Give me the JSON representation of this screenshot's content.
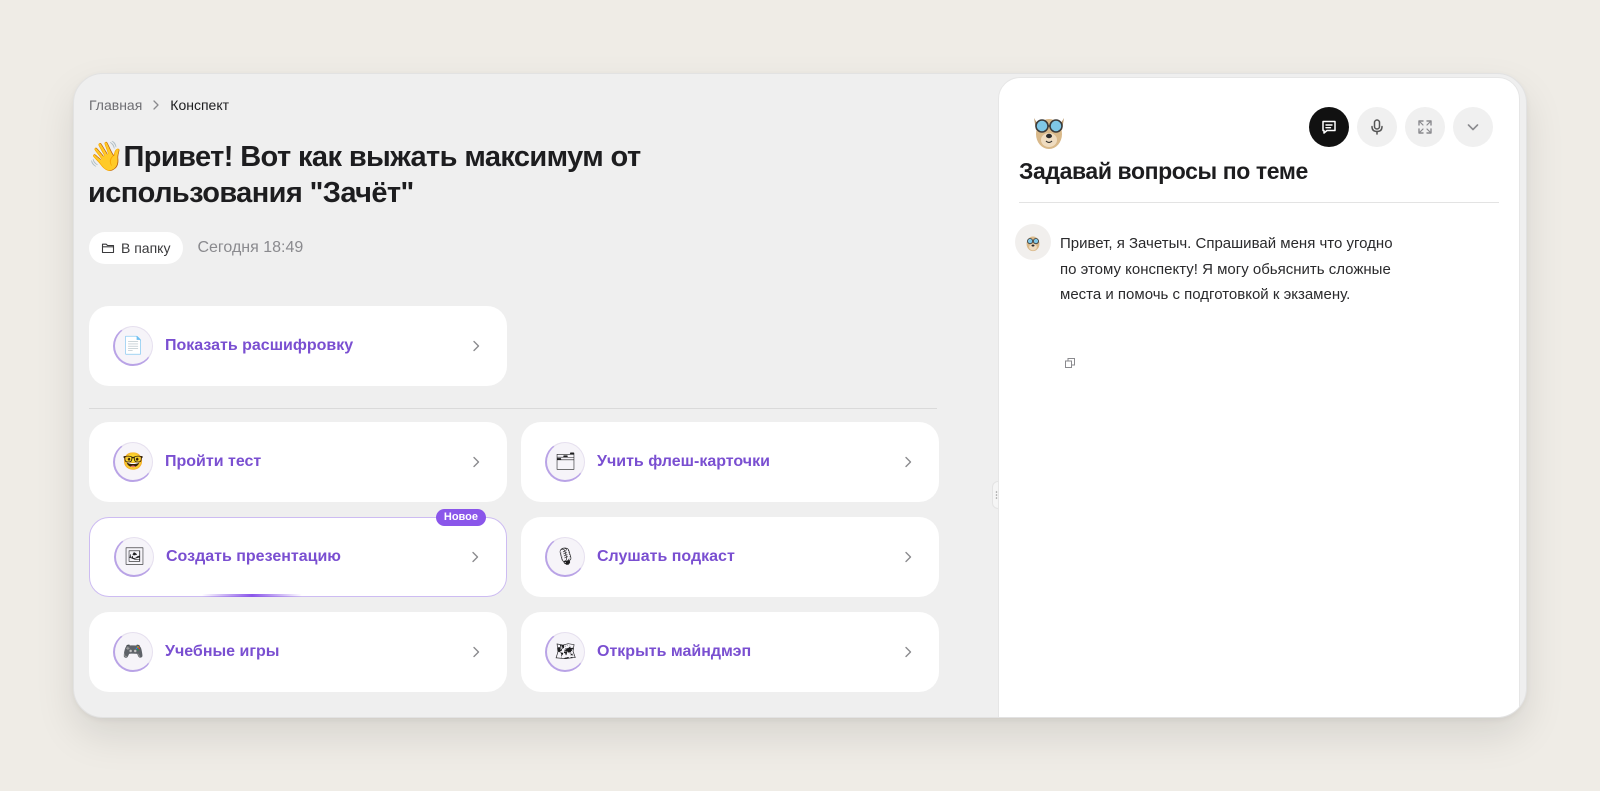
{
  "breadcrumb": {
    "home": "Главная",
    "current": "Конспект",
    "separator_icon": "chevron-right-icon"
  },
  "title": {
    "emoji": "👋",
    "text": "Привет! Вот как выжать максимум от использования \"Зачёт\""
  },
  "meta": {
    "folder_button": "В папку",
    "folder_icon": "folder-icon",
    "date": "Сегодня 18:49"
  },
  "transcript_card": {
    "label": "Показать расшифровку",
    "icon": "📄"
  },
  "actions": [
    {
      "id": "test",
      "label": "Пройти тест",
      "icon": "🤓"
    },
    {
      "id": "flashcards",
      "label": "Учить флеш-карточки",
      "icon": "🗂"
    },
    {
      "id": "presentation",
      "label": "Создать презентацию",
      "icon": "🖼",
      "badge": "Новое"
    },
    {
      "id": "podcast",
      "label": "Слушать подкаст",
      "icon": "🎙"
    },
    {
      "id": "games",
      "label": "Учебные игры",
      "icon": "🎮"
    },
    {
      "id": "mindmap",
      "label": "Открыть майндмэп",
      "icon": "🗺"
    }
  ],
  "chat": {
    "title": "Задавай вопросы по теме",
    "message": "Привет, я Зачетыч. Спрашивай меня что угодно по этому конспекту! Я могу обьяснить сложные места и помочь с подготовкой к экзамену.",
    "tools": [
      "chat-icon",
      "microphone-icon",
      "expand-icon",
      "chevron-down-icon"
    ]
  },
  "colors": {
    "accent": "#7a4fd1",
    "badge": "#8a56ea",
    "background": "#efece6",
    "panel": "#efefef"
  }
}
